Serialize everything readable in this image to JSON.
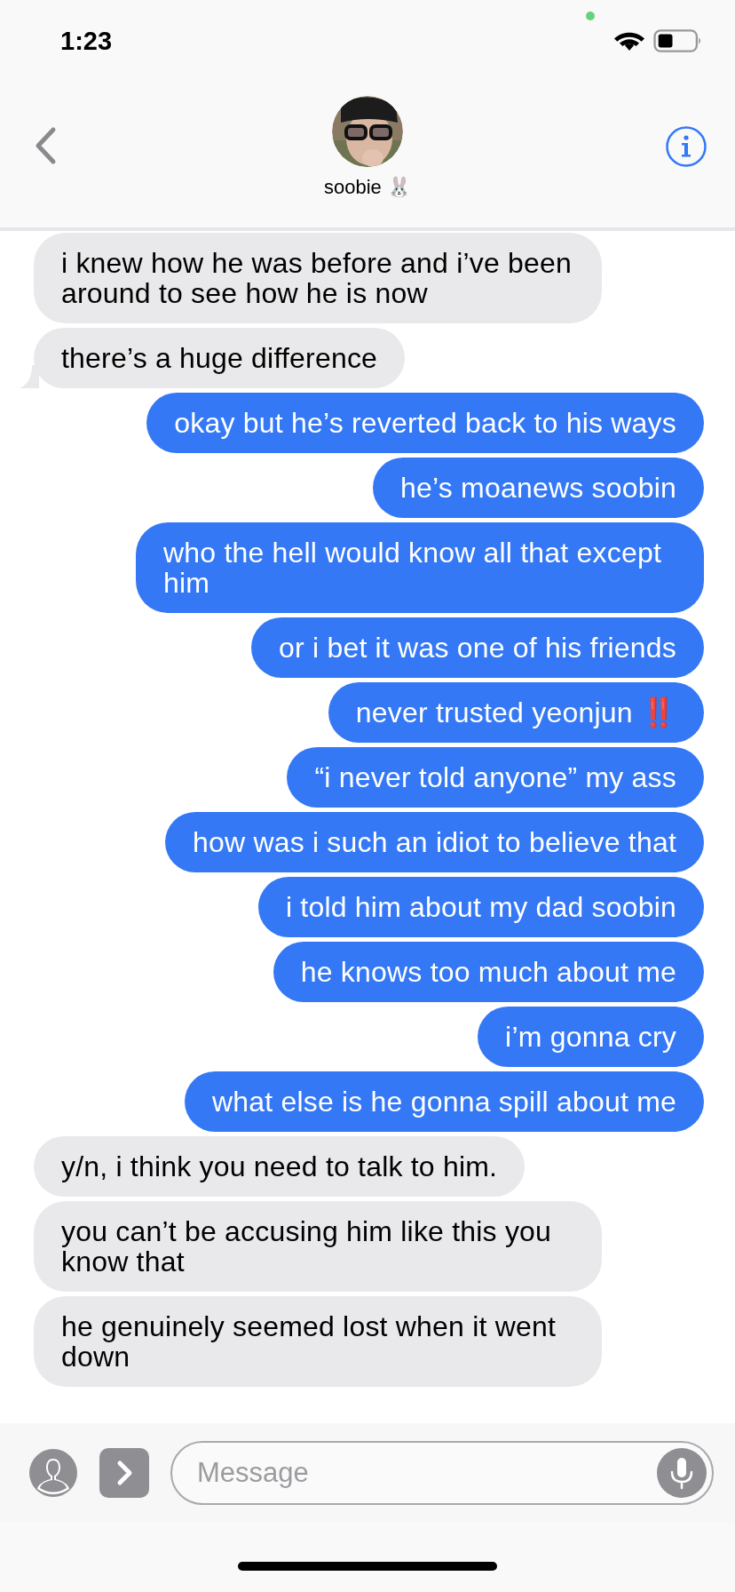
{
  "status_bar": {
    "time": "1:23"
  },
  "header": {
    "contact_name": "soobie 🐰"
  },
  "messages": [
    {
      "kind": "received",
      "text": "i knew how he was before and i’ve been around to see how he is now",
      "tail": false
    },
    {
      "kind": "received",
      "text": "there’s a huge difference",
      "tail": true
    },
    {
      "kind": "sent",
      "text": "okay but he’s reverted back to his ways",
      "tail": false
    },
    {
      "kind": "sent",
      "text": "he’s moanews soobin",
      "tail": false
    },
    {
      "kind": "sent",
      "text": "who the hell would know all that except him",
      "tail": false
    },
    {
      "kind": "sent",
      "text": "or i bet it was one of his friends",
      "tail": false
    },
    {
      "kind": "sent",
      "text": "never trusted yeonjun ‼️",
      "tail": false
    },
    {
      "kind": "sent",
      "text": "“i never told anyone” my ass",
      "tail": false
    },
    {
      "kind": "sent",
      "text": "how was i such an idiot to believe that",
      "tail": false
    },
    {
      "kind": "sent",
      "text": "i told him about my dad soobin",
      "tail": false
    },
    {
      "kind": "sent",
      "text": "he knows too much about me",
      "tail": false
    },
    {
      "kind": "sent",
      "text": "i’m gonna cry",
      "tail": false
    },
    {
      "kind": "sent",
      "text": "what else is he gonna spill about me",
      "tail": false
    },
    {
      "kind": "received",
      "text": "y/n, i think you need to talk to him.",
      "tail": false
    },
    {
      "kind": "received",
      "text": "you can’t be accusing him like this you know that",
      "tail": false
    },
    {
      "kind": "received",
      "text": "he genuinely seemed lost when it went down",
      "tail": false
    }
  ],
  "composer": {
    "placeholder": "Message"
  }
}
